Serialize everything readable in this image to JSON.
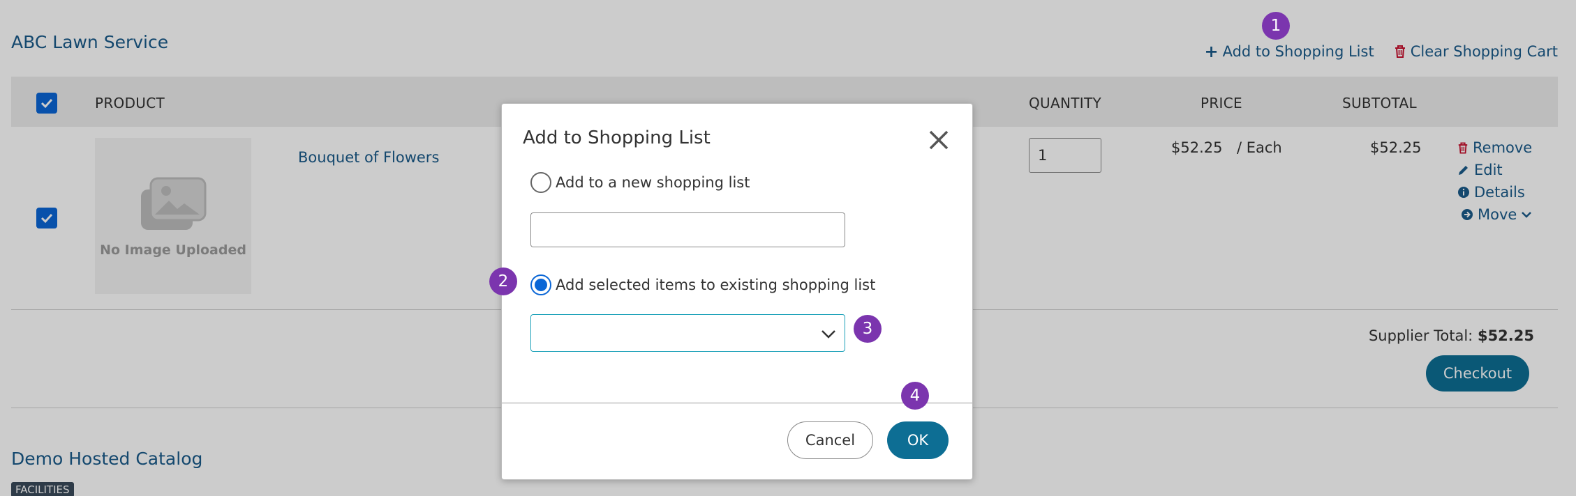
{
  "supplier": {
    "name": "ABC Lawn Service",
    "add_to_list_label": "Add to Shopping List",
    "clear_cart_label": "Clear Shopping Cart"
  },
  "table": {
    "headers": {
      "product": "PRODUCT",
      "quantity": "QUANTITY",
      "price": "PRICE",
      "subtotal": "SUBTOTAL"
    },
    "rows": [
      {
        "image_text": "No Image Uploaded",
        "product": "Bouquet of Flowers",
        "quantity": "1",
        "price": "$52.25",
        "unit": "/ Each",
        "subtotal": "$52.25",
        "actions": {
          "remove": "Remove",
          "edit": "Edit",
          "details": "Details",
          "move": "Move"
        }
      }
    ]
  },
  "supplier_total": {
    "label": "Supplier Total:",
    "value": "$52.25"
  },
  "checkout_label": "Checkout",
  "catalog": {
    "name": "Demo Hosted Catalog",
    "badge": "FACILITIES"
  },
  "modal": {
    "title": "Add to Shopping List",
    "option_new": "Add to a new shopping list",
    "new_list_value": "",
    "option_existing": "Add selected items to existing shopping list",
    "existing_selected": "",
    "cancel_label": "Cancel",
    "ok_label": "OK"
  },
  "steps": [
    "1",
    "2",
    "3",
    "4"
  ],
  "colors": {
    "link": "#1a5a8a",
    "primary_button": "#0d6e94",
    "checkbox": "#0a66d6",
    "step_badge": "#7b35ae",
    "danger_icon": "#c8102e"
  }
}
